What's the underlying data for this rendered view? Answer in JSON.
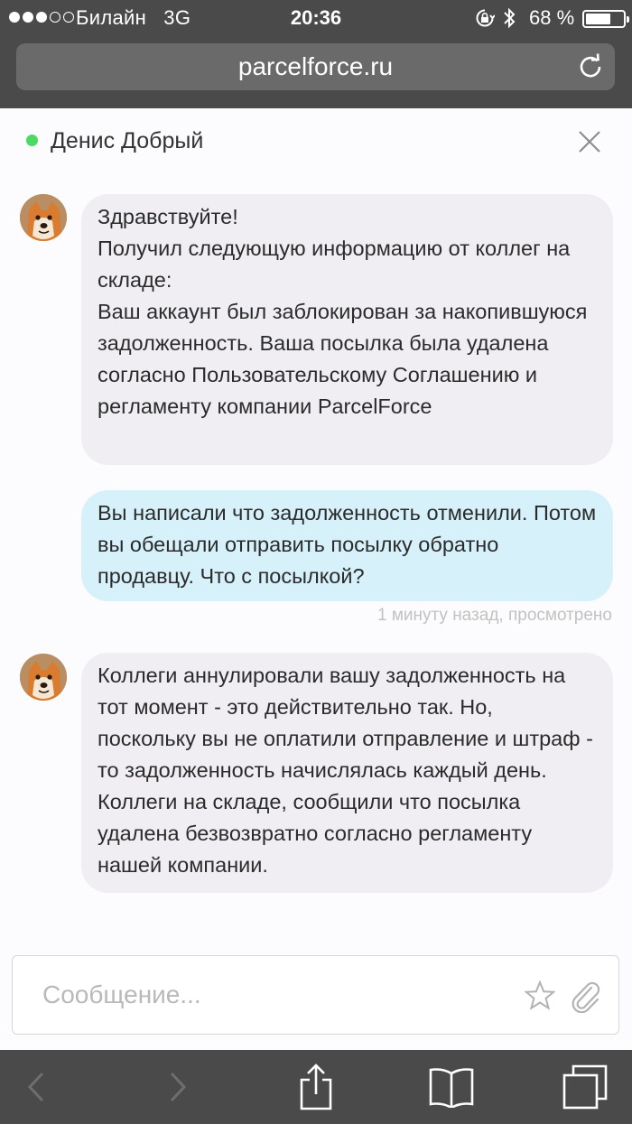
{
  "status_bar": {
    "carrier": "Билайн",
    "network": "3G",
    "time": "20:36",
    "battery": "68 %",
    "battery_level": 0.68
  },
  "browser": {
    "url": "parcelforce.ru"
  },
  "chat": {
    "contact_name": "Денис Добрый",
    "online_color": "#4cd964",
    "messages": [
      {
        "direction": "incoming",
        "text": "Здравствуйте!\nПолучил следующую информацию от коллег на складе:\nВаш аккаунт был заблокирован за накопившуюся задолженность. Ваша посылка была удалена согласно Пользовательскому Соглашению и регламенту компании ParcelForce"
      },
      {
        "direction": "outgoing",
        "text": "Вы написали что задолженность отменили. Потом вы обещали отправить посылку обратно продавцу. Что с посылкой?",
        "meta": "1 минуту назад, просмотрено"
      },
      {
        "direction": "incoming",
        "text": "Коллеги аннулировали вашу задолженность на тот момент - это действительно так. Но, поскольку вы не оплатили отправление и штраф - то задолженность начислялась каждый день. Коллеги на складе, сообщили что посылка удалена безвозвратно согласно регламенту нашей компании."
      }
    ]
  },
  "composer": {
    "placeholder": "Сообщение...",
    "value": ""
  },
  "icons": {
    "status": [
      "signal-dots-icon",
      "lock-rotation-icon",
      "bluetooth-icon",
      "battery-icon"
    ],
    "header": [
      "online-dot-icon",
      "close-icon"
    ],
    "composer": [
      "star-icon",
      "paperclip-icon"
    ],
    "toolbar": [
      "back-icon",
      "forward-icon",
      "share-icon",
      "bookmarks-icon",
      "tabs-icon"
    ]
  }
}
